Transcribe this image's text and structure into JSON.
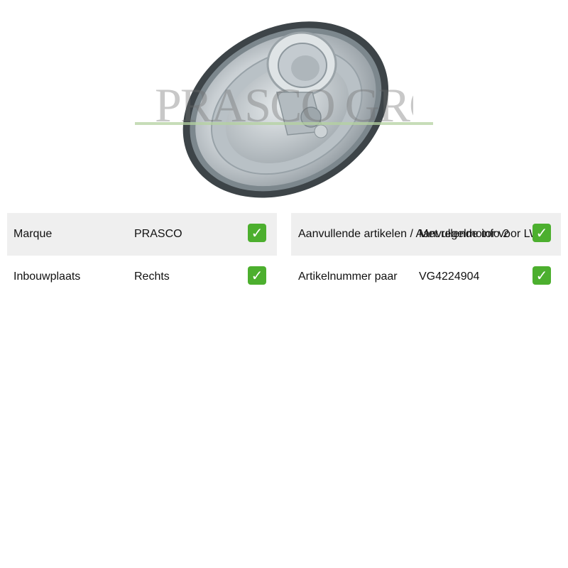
{
  "watermark": {
    "text": "PRASCO GROUP"
  },
  "product_image": {
    "subject": "headlight-assembly"
  },
  "specs": {
    "left": [
      {
        "label": "Marque",
        "value": "PRASCO",
        "check": "✓"
      },
      {
        "label": "Inbouwplaats",
        "value": "Rechts",
        "check": "✓"
      }
    ],
    "right": [
      {
        "label": "Aanvullende artikelen / Aanvullende info 2",
        "value": "Met regelmotor voor LWR",
        "check": "✓"
      },
      {
        "label": "Artikelnummer paar",
        "value": "VG4224904",
        "check": "✓"
      }
    ]
  },
  "colors": {
    "row_shade": "#efefef",
    "check_bg": "#4caf2e"
  }
}
